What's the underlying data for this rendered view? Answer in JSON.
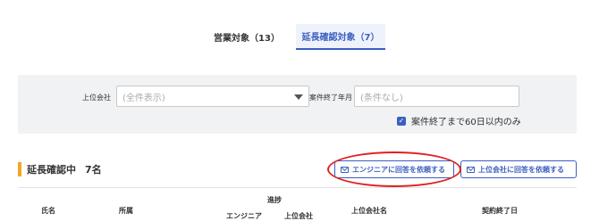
{
  "tabs": [
    {
      "label": "営業対象（13）",
      "active": false
    },
    {
      "label": "延長確認対象（7）",
      "active": true
    }
  ],
  "filter": {
    "company_label": "上位会社",
    "company_value": "(全件表示)",
    "enddate_label": "案件終了年月",
    "enddate_placeholder": "(条件なし)",
    "checkbox_label": "案件終了まで60日以内のみ",
    "checkbox_checked": true
  },
  "section": {
    "title": "延長確認中",
    "count": "7名"
  },
  "buttons": {
    "engineer": "エンジニアに回答を依頼する",
    "top_company": "上位会社に回答を依頼する"
  },
  "table": {
    "headers": {
      "name": "氏名",
      "org": "所属",
      "progress": "進捗",
      "engineer": "エンジニア",
      "top_company": "上位会社",
      "top_company_name": "上位会社名",
      "contract_end": "契約終了日"
    }
  },
  "colors": {
    "accent": "#3b5fc0",
    "section_bar": "#f5a623",
    "annotation_circle": "#e02020"
  }
}
